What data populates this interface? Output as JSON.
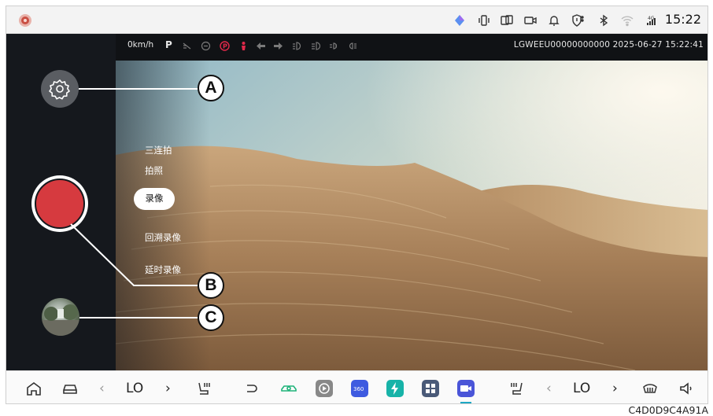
{
  "status_bar": {
    "time": "15:22",
    "icons": [
      "app-logo-icon",
      "gem-icon",
      "phone-vibrate-icon",
      "screen-cast-icon",
      "camera-icon",
      "bell-icon",
      "shield-icon",
      "bluetooth-icon",
      "wifi-icon",
      "signal-4g-icon"
    ]
  },
  "recorder_info": {
    "speed": "0km/h",
    "gear": "P",
    "vin": "LGWEEU00000000000",
    "datetime": "2025-06-27 15:22:41"
  },
  "camera_modes": {
    "burst": "三连拍",
    "photo": "拍照",
    "video": "录像",
    "rewind_video": "回溯录像",
    "timelapse": "延时录像",
    "active": "录像"
  },
  "callouts": {
    "a": "A",
    "b": "B",
    "c": "C"
  },
  "dock": {
    "left_temp": "LO",
    "right_temp": "LO"
  },
  "colors": {
    "record": "#d63a3f",
    "active_indicator": "#1fa8c4",
    "parking_indicator": "#e0294a"
  },
  "footer": {
    "code": "C4D0D9C4A91A"
  }
}
